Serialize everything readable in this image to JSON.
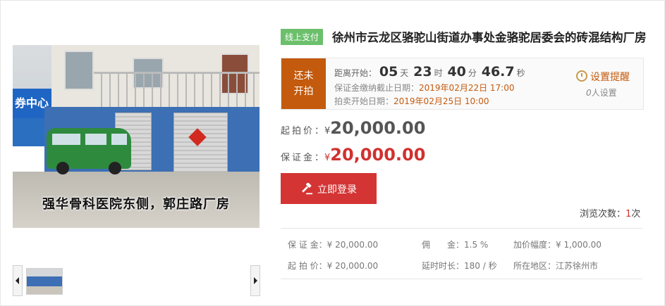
{
  "gallery": {
    "photo_caption": "强华骨科医院东侧，郭庄路厂房",
    "sign_text": "券中心"
  },
  "header": {
    "tag": "线上支付",
    "title": "徐州市云龙区骆驼山街道办事处金骆驼居委会的砖混结构厂房"
  },
  "countdown": {
    "status": [
      "还未",
      "开拍"
    ],
    "label": "距离开始：",
    "days": "05",
    "days_unit": "天",
    "hours": "23",
    "hours_unit": "时",
    "minutes": "40",
    "minutes_unit": "分",
    "seconds": "46.7",
    "seconds_unit": "秒",
    "deposit_deadline_label": "保证金缴纳截止日期：",
    "deposit_deadline": "2019年02月22日 17:00",
    "auction_start_label": "拍卖开始日期：",
    "auction_start": "2019年02月25日 10:00",
    "remind_label": "设置提醒",
    "remind_count": "0",
    "remind_suffix": "人设置"
  },
  "prices": {
    "start_label": "起拍价：",
    "start_yen": "¥",
    "start_amount": "20,000.00",
    "deposit_label": "保证金：",
    "deposit_yen": "¥",
    "deposit_amount": "20,000.00"
  },
  "actions": {
    "login_label": "立即登录"
  },
  "views": {
    "label": "浏览次数：",
    "count": "1",
    "unit": "次"
  },
  "details": {
    "deposit": "保 证 金：¥ 20,000.00",
    "commission": "佣　　金：1.5 %",
    "increment": "加价幅度：¥ 1,000.00",
    "start_price": "起 拍 价：¥ 20,000.00",
    "delay": "延时时长：180 / 秒",
    "region": "所在地区：江苏徐州市"
  },
  "colors": {
    "accent_red": "#d53434",
    "status_orange": "#c45a0d",
    "tag_green": "#6cc06c"
  }
}
